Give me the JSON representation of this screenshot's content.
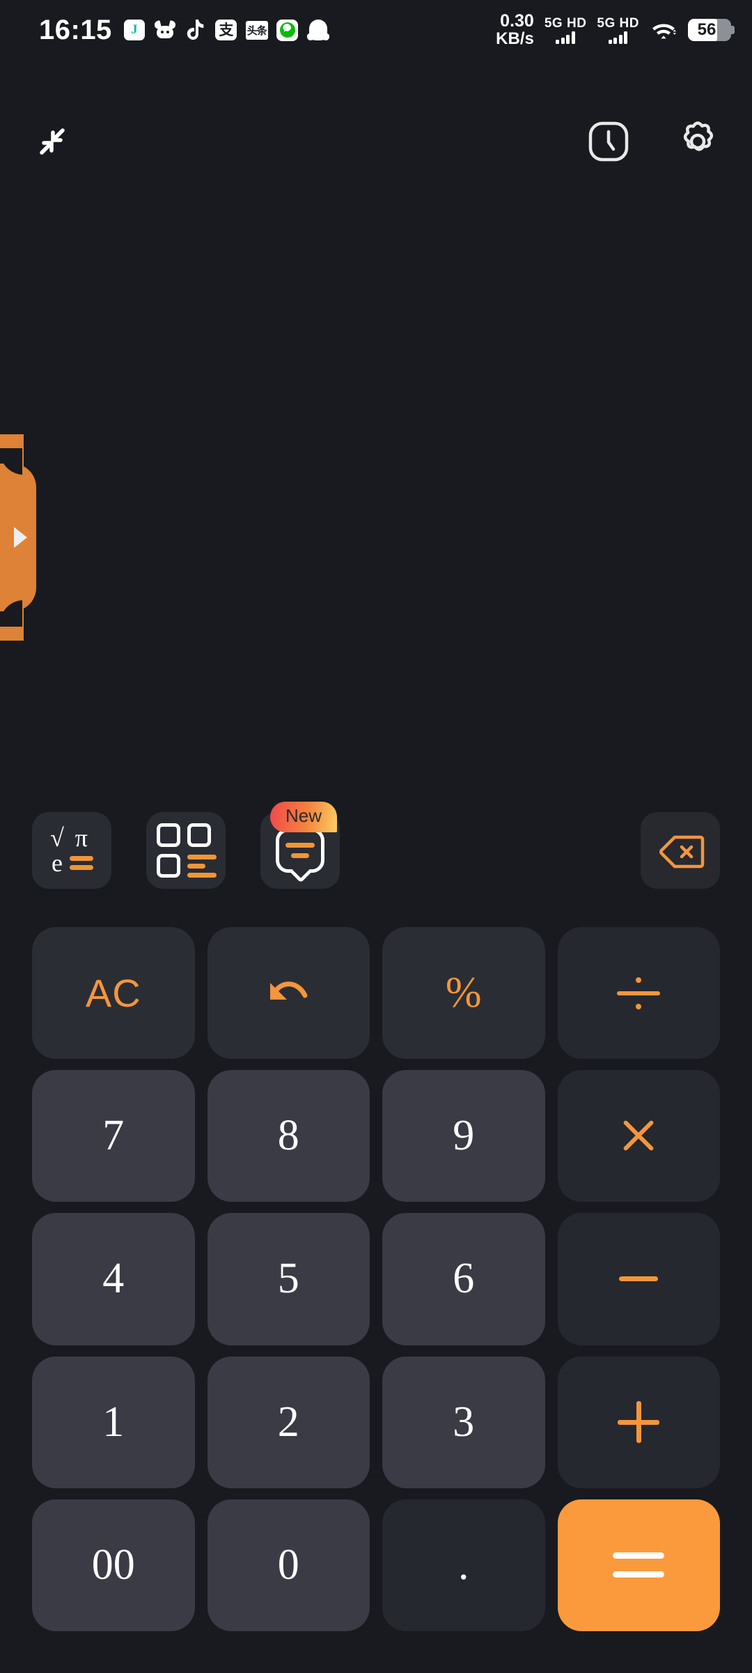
{
  "status_bar": {
    "time": "16:15",
    "notification_icons": [
      "note-app-icon",
      "bull-app-icon",
      "tiktok-icon",
      "alipay-icon",
      "toutiao-icon",
      "wechat-icon",
      "qq-icon"
    ],
    "toutiao_label": "头条",
    "alipay_label": "支",
    "note_label": "J",
    "network_speed": "0.30",
    "network_speed_unit": "KB/s",
    "sim1_label": "5G HD",
    "sim2_label": "5G HD",
    "wifi": "wifi-icon",
    "battery_level": "56"
  },
  "toolbar": {
    "collapse_icon": "collapse-arrows-icon",
    "history_icon": "history-clock-icon",
    "settings_icon": "settings-gear-icon"
  },
  "side_drawer": {
    "handle_icon": "chevron-right-icon",
    "color": "#dd8236"
  },
  "display": {
    "expression": "",
    "result": ""
  },
  "function_row": {
    "scientific": {
      "name": "scientific-mode-button",
      "sym_sqrt": "√",
      "sym_pi": "π",
      "sym_e": "e"
    },
    "converter": {
      "name": "unit-converter-button"
    },
    "chat": {
      "name": "ai-chat-button",
      "badge": "New"
    },
    "backspace": {
      "name": "backspace-button"
    }
  },
  "keypad": {
    "keys": [
      {
        "label": "AC",
        "name": "key-all-clear",
        "type": "fn"
      },
      {
        "label": "",
        "name": "key-undo",
        "type": "fn"
      },
      {
        "label": "%",
        "name": "key-percent",
        "type": "fn"
      },
      {
        "label": "÷",
        "name": "key-divide",
        "type": "op"
      },
      {
        "label": "7",
        "name": "key-7",
        "type": "num"
      },
      {
        "label": "8",
        "name": "key-8",
        "type": "num"
      },
      {
        "label": "9",
        "name": "key-9",
        "type": "num"
      },
      {
        "label": "×",
        "name": "key-multiply",
        "type": "op"
      },
      {
        "label": "4",
        "name": "key-4",
        "type": "num"
      },
      {
        "label": "5",
        "name": "key-5",
        "type": "num"
      },
      {
        "label": "6",
        "name": "key-6",
        "type": "num"
      },
      {
        "label": "−",
        "name": "key-subtract",
        "type": "op"
      },
      {
        "label": "1",
        "name": "key-1",
        "type": "num"
      },
      {
        "label": "2",
        "name": "key-2",
        "type": "num"
      },
      {
        "label": "3",
        "name": "key-3",
        "type": "num"
      },
      {
        "label": "+",
        "name": "key-add",
        "type": "op"
      },
      {
        "label": "00",
        "name": "key-double-zero",
        "type": "num"
      },
      {
        "label": "0",
        "name": "key-0",
        "type": "num"
      },
      {
        "label": ".",
        "name": "key-decimal",
        "type": "op"
      },
      {
        "label": "=",
        "name": "key-equals",
        "type": "eq"
      }
    ]
  },
  "colors": {
    "background": "#181a1f",
    "key_number": "#3a3b44",
    "key_operator": "#26282f",
    "key_function": "#2b2d35",
    "accent_orange": "#f4963c",
    "equals_orange": "#fb9a3c"
  }
}
